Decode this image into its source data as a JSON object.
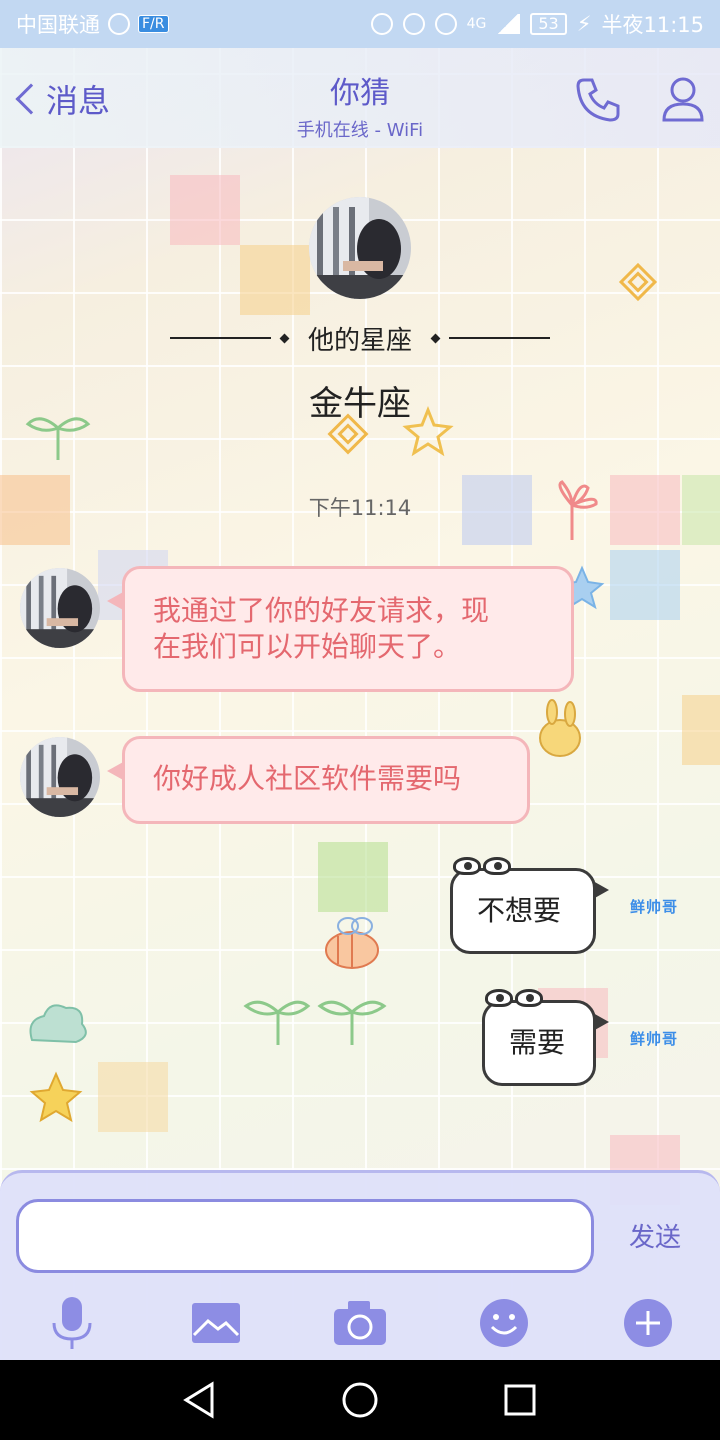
{
  "status_bar": {
    "carrier": "中国联通",
    "badge": "F/R",
    "network": "4G",
    "battery": "53",
    "time": "半夜11:15"
  },
  "header": {
    "back_label": "消息",
    "title": "你猜",
    "subtitle": "手机在线 - WiFi",
    "call_icon": "phone-icon",
    "profile_icon": "person-icon"
  },
  "profile_card": {
    "label": "他的星座",
    "value": "金牛座"
  },
  "timestamp": "下午11:14",
  "messages": [
    {
      "from": "them",
      "text_line1": "我通过了你的好友请求，现",
      "text_line2": "在我们可以开始聊天了。"
    },
    {
      "from": "them",
      "text": "你好成人社区软件需要吗"
    },
    {
      "from": "me",
      "text": "不想要"
    },
    {
      "from": "me",
      "text": "需要"
    }
  ],
  "sender_tag": "鲜帅哥",
  "input": {
    "value": "",
    "send_label": "发送"
  },
  "toolbar": [
    "microphone-icon",
    "image-icon",
    "camera-icon",
    "emoji-icon",
    "plus-icon"
  ],
  "colors": {
    "accent": "#6f6bd2",
    "incoming_bg": "#ffeaea",
    "incoming_border": "#f4b6ba",
    "incoming_text": "#e4686f",
    "status_bar": "#c2d8f2"
  }
}
